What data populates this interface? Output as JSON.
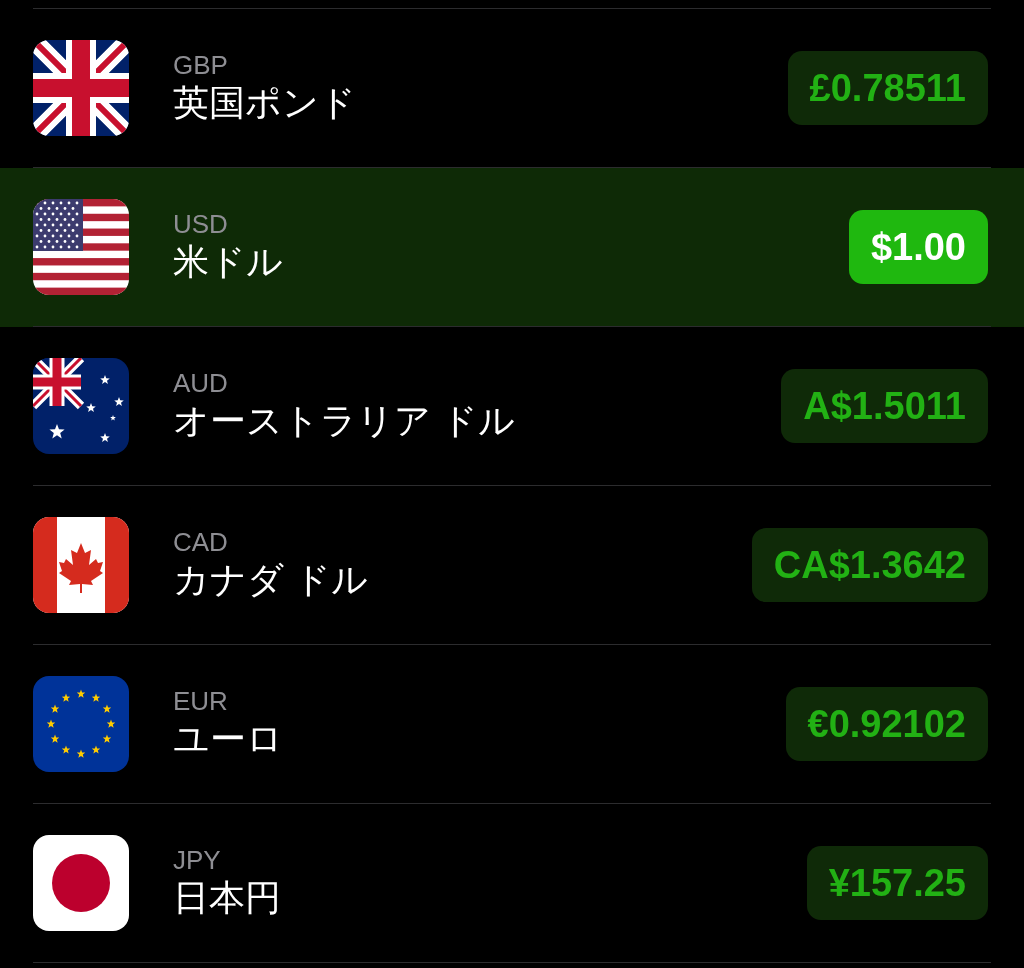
{
  "currencies": [
    {
      "code": "GBP",
      "name": "英国ポンド",
      "value": "£0.78511",
      "selected": false
    },
    {
      "code": "USD",
      "name": "米ドル",
      "value": "$1.00",
      "selected": true
    },
    {
      "code": "AUD",
      "name": "オーストラリア ドル",
      "value": "A$1.5011",
      "selected": false
    },
    {
      "code": "CAD",
      "name": "カナダ ドル",
      "value": "CA$1.3642",
      "selected": false
    },
    {
      "code": "EUR",
      "name": "ユーロ",
      "value": "€0.92102",
      "selected": false
    },
    {
      "code": "JPY",
      "name": "日本円",
      "value": "¥157.25",
      "selected": false
    }
  ]
}
